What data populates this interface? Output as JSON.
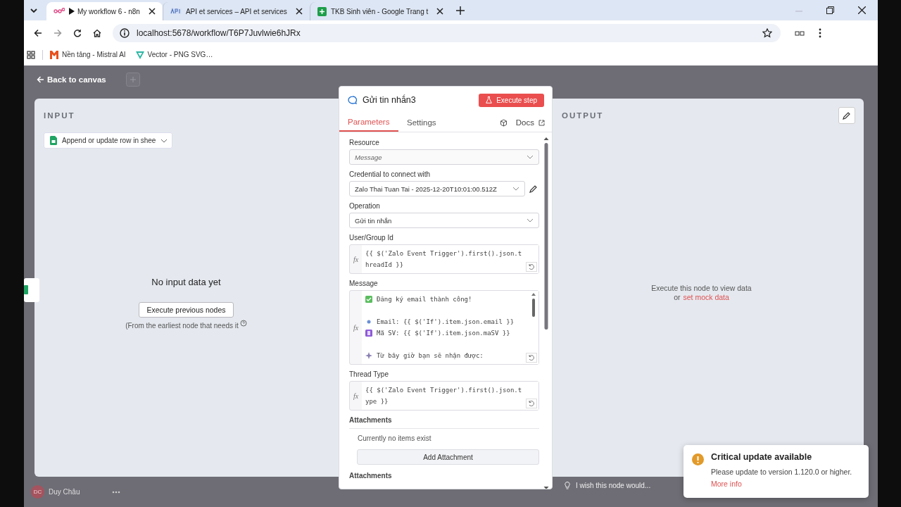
{
  "browser": {
    "tabs": [
      {
        "kind": "n8n",
        "title": "My workflow 6 - n8n",
        "playing": true,
        "selected": true
      },
      {
        "kind": "api",
        "title": "API et services – API et services",
        "playing": false,
        "selected": false
      },
      {
        "kind": "sheets",
        "title": "TKB Sinh viên - Google Trang t",
        "playing": false,
        "selected": false
      }
    ],
    "address": "localhost:5678/workflow/T6P7Juvlwie6hJRx",
    "bookmarks": [
      {
        "kind": "mistral",
        "title": "Nền tảng - Mistral AI"
      },
      {
        "kind": "vector",
        "title": "Vector - PNG SVG…"
      }
    ]
  },
  "ndv": {
    "back": "Back to canvas",
    "input": {
      "heading": "INPUT",
      "source": "Append or update row in shee",
      "empty_title": "No input data yet",
      "button": "Execute previous nodes",
      "note": "(From the earliest node that needs it"
    },
    "node": {
      "title": "Gửi tin nhắn3",
      "execute": "Execute step",
      "tabs": [
        {
          "label": "Parameters",
          "selected": true
        },
        {
          "label": "Settings",
          "selected": false
        }
      ],
      "docs": "Docs",
      "fields": [
        {
          "kind": "select",
          "label": "Resource",
          "value": "Message",
          "disabled": true,
          "editable": false
        },
        {
          "kind": "select",
          "label": "Credential to connect with",
          "value": "Zalo Thai Tuan Tai - 2025-12-20T10:01:00.512Z",
          "disabled": false,
          "editable": true
        },
        {
          "kind": "select",
          "label": "Operation",
          "value": "Gửi tin nhắn",
          "disabled": false,
          "editable": false
        },
        {
          "kind": "expression",
          "label": "User/Group Id",
          "fx_label": "fx",
          "value": "{{ $('Zalo Event Trigger').first().json.threadId }}"
        },
        {
          "kind": "message",
          "label": "Message",
          "fx_label": "fx",
          "lines": [
            {
              "kind": "check",
              "text": "Đăng ký email thành công!"
            },
            {
              "kind": "blank"
            },
            {
              "kind": "dot",
              "text": "Email: {{ $('If').item.json.email }}"
            },
            {
              "kind": "card",
              "text": "Mã SV: {{ $('If').item.json.maSV }}"
            },
            {
              "kind": "blank"
            },
            {
              "kind": "sparkle",
              "text": "Từ bây giờ bạn sẽ nhận được:"
            }
          ]
        },
        {
          "kind": "expression",
          "label": "Thread Type",
          "fx_label": "fx",
          "value": "{{ $('Zalo Event Trigger').first().json.type }}"
        },
        {
          "kind": "collection",
          "label": "Attachments",
          "empty_text": "Currently no items exist",
          "button": "Add Attachment"
        },
        {
          "kind": "heading",
          "label": "Attachments"
        }
      ]
    },
    "output": {
      "heading": "OUTPUT",
      "message": "Execute this node to view data",
      "link_prefix": "or",
      "link": "set mock data"
    },
    "feedback": "I wish this node would..."
  },
  "user": {
    "initials": "DC",
    "name": "Duy Châu"
  },
  "toast": {
    "title": "Critical update available",
    "message": "Please update to version 1.120.0 or higher.",
    "link": "More info"
  }
}
